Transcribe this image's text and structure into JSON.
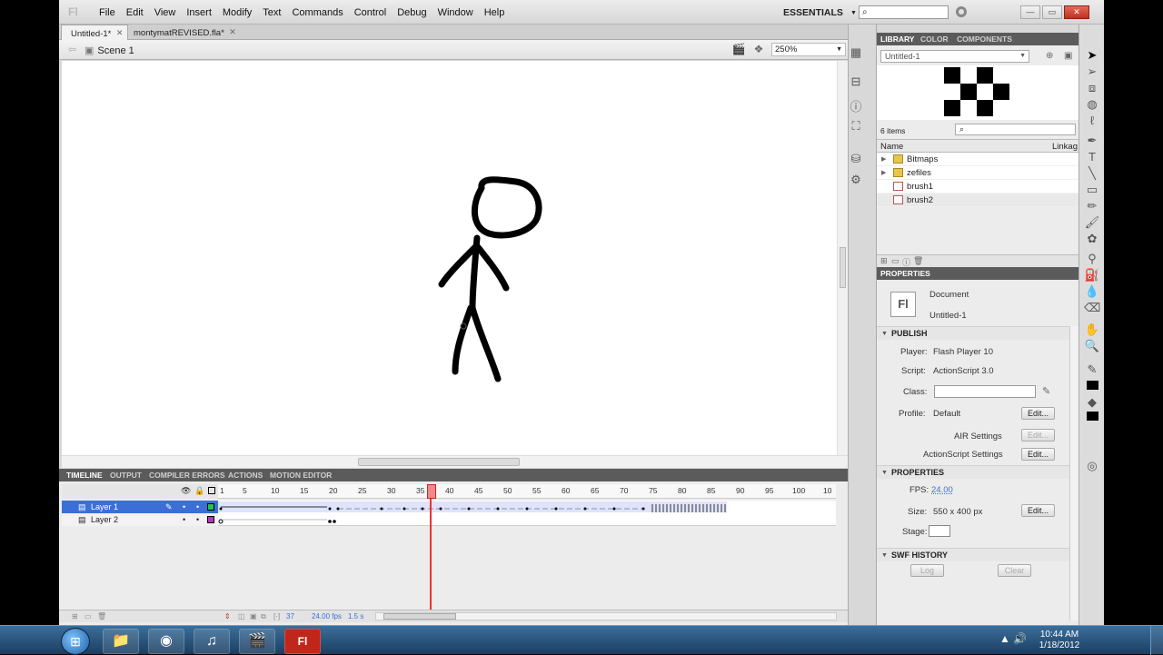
{
  "app": {
    "logo": "Fl",
    "menus": [
      "File",
      "Edit",
      "View",
      "Insert",
      "Modify",
      "Text",
      "Commands",
      "Control",
      "Debug",
      "Window",
      "Help"
    ],
    "workspace": "ESSENTIALS",
    "search_placeholder": "",
    "window_buttons": {
      "minimize": "—",
      "maximize": "▭",
      "close": "✕"
    }
  },
  "doc_tabs": [
    {
      "label": "Untitled-1*",
      "close": "✕"
    },
    {
      "label": "montymatREVISED.fla*",
      "close": "✕"
    }
  ],
  "editbar": {
    "scene": "Scene 1",
    "zoom": "250%"
  },
  "timeline": {
    "tabs": [
      "TIMELINE",
      "OUTPUT",
      "COMPILER ERRORS",
      "ACTIONS",
      "MOTION EDITOR"
    ],
    "frame_numbers": [
      "1",
      "5",
      "10",
      "15",
      "20",
      "25",
      "30",
      "35",
      "40",
      "45",
      "50",
      "55",
      "60",
      "65",
      "70",
      "75",
      "80",
      "85",
      "90",
      "95",
      "100",
      "10"
    ],
    "layers": [
      {
        "name": "Layer 1",
        "color": "#27c24c"
      },
      {
        "name": "Layer 2",
        "color": "#b33ab8"
      }
    ],
    "current_frame": "37",
    "fps": "24.00 fps",
    "time": "1.5 s"
  },
  "library": {
    "tabs": [
      "LIBRARY",
      "COLOR",
      "COMPONENTS"
    ],
    "document": "Untitled-1",
    "count": "6 items",
    "col_name": "Name",
    "col_linkage": "Linkag",
    "items": [
      {
        "name": "Bitmaps",
        "type": "folder"
      },
      {
        "name": "zefiles",
        "type": "folder"
      },
      {
        "name": "brush1",
        "type": "symbol"
      },
      {
        "name": "brush2",
        "type": "symbol"
      }
    ]
  },
  "properties": {
    "title": "PROPERTIES",
    "icon": "Fl",
    "doc_type": "Document",
    "doc_name": "Untitled-1",
    "publish_header": "PUBLISH",
    "player_label": "Player:",
    "player": "Flash Player 10",
    "script_label": "Script:",
    "script": "ActionScript 3.0",
    "class_label": "Class:",
    "profile_label": "Profile:",
    "profile": "Default",
    "edit": "Edit...",
    "air": "AIR Settings",
    "as_settings": "ActionScript Settings",
    "props_header": "PROPERTIES",
    "fps_label": "FPS:",
    "fps": "24.00",
    "size_label": "Size:",
    "size": "550 x 400 px",
    "stage_label": "Stage:",
    "swf_header": "SWF HISTORY",
    "log": "Log",
    "clear": "Clear"
  },
  "taskbar": {
    "time": "10:44 AM",
    "date": "1/18/2012",
    "apps": [
      "explorer",
      "chrome",
      "itunes",
      "media",
      "flash"
    ]
  }
}
